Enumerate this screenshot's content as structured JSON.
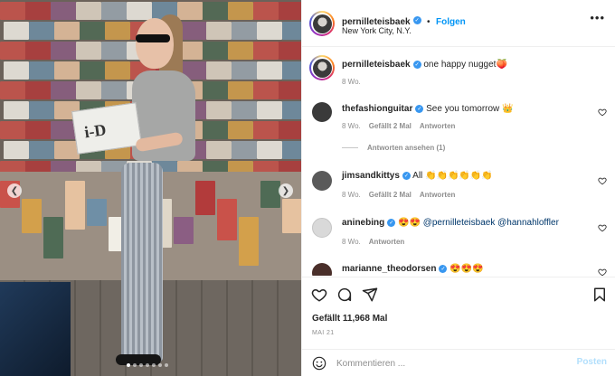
{
  "post": {
    "author": "pernilleteisbaek",
    "follow_label": "Folgen",
    "location": "New York City, N.Y.",
    "caption_text": "one happy nugget",
    "caption_emoji": "🍑",
    "caption_age": "8 Wo.",
    "likes": "Gefällt 11,968 Mal",
    "date": "MAI 21",
    "photo_magazine_text": "i-D"
  },
  "comments": [
    {
      "user": "thefashionguitar",
      "text": "See you tomorrow",
      "emoji": "👑",
      "age": "8 Wo.",
      "likes": "Gefällt 2 Mal",
      "reply": "Antworten",
      "view_replies": "Antworten ansehen (1)",
      "avatar_color": "#3a3a3a"
    },
    {
      "user": "jimsandkittys",
      "text": "All",
      "emoji": "👏👏👏👏👏👏",
      "age": "8 Wo.",
      "likes": "Gefällt 2 Mal",
      "reply": "Antworten",
      "avatar_color": "#5a5a5a"
    },
    {
      "user": "aninebing",
      "emoji": "😍😍",
      "text": "@pernilleteisbaek @hannahloffler",
      "age": "8 Wo.",
      "reply": "Antworten",
      "avatar_color": "#d9d9d9"
    },
    {
      "user": "marianne_theodorsen",
      "emoji": "😍😍😍",
      "avatar_color": "#4a2f2a"
    }
  ],
  "compose": {
    "placeholder": "Kommentieren ...",
    "post_label": "Posten"
  },
  "carousel": {
    "slide_count": 7,
    "active_index": 0
  },
  "colors": {
    "link_blue": "#0095f6",
    "verified_blue": "#3897f0",
    "muted": "#8e8e8e"
  },
  "icons": [
    "more-icon",
    "heart-icon",
    "comment-icon",
    "share-icon",
    "bookmark-icon",
    "emoji-icon",
    "chevron-left-icon",
    "chevron-right-icon",
    "verified-icon"
  ]
}
